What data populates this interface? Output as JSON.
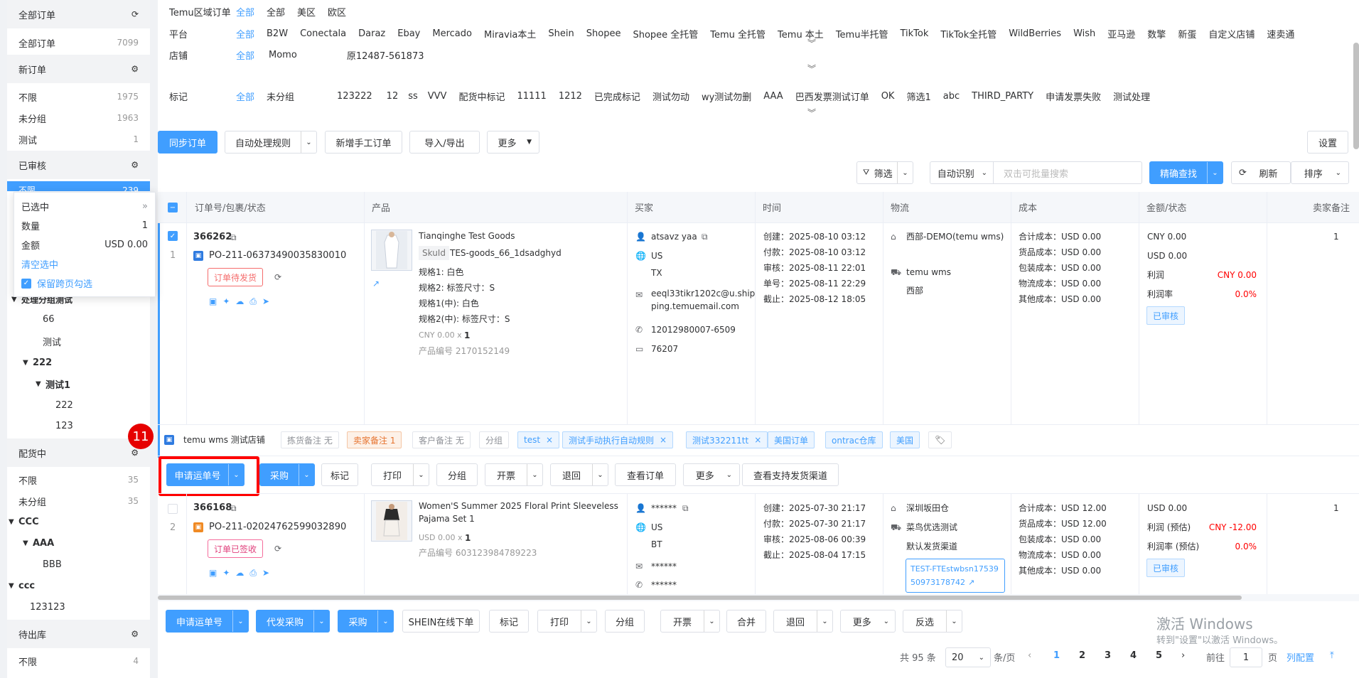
{
  "sidebar": {
    "all_orders": {
      "title": "全部订单",
      "item": {
        "label": "全部订单",
        "count": "7099"
      }
    },
    "new_orders": {
      "title": "新订单",
      "items": [
        {
          "label": "不限",
          "count": "1975"
        },
        {
          "label": "未分组",
          "count": "1963"
        },
        {
          "label": "测试",
          "count": "1"
        }
      ]
    },
    "approved": {
      "title": "已审核",
      "active_label": "不限",
      "active_count": "239"
    },
    "tree_a": {
      "group": "处理分组测试",
      "items": [
        "66",
        "测试"
      ],
      "sub": "222",
      "sub2": "测试1",
      "leaves": [
        "222",
        "123"
      ]
    },
    "picking": {
      "title": "配货中",
      "items": [
        {
          "label": "不限",
          "count": "35"
        },
        {
          "label": "未分组",
          "count": "35"
        }
      ],
      "tree": {
        "a": "CCC",
        "b": "AAA",
        "c": "BBB",
        "d": "ccc",
        "e": "123123"
      }
    },
    "outbound": {
      "title": "待出库",
      "items": [
        {
          "label": "不限",
          "count": "4"
        }
      ]
    }
  },
  "popover": {
    "selected": "已选中",
    "qty_label": "数量",
    "qty": "1",
    "amount_label": "金额",
    "amount": "USD 0.00",
    "clear": "清空选中",
    "keep": "保留跨页勾选"
  },
  "filters": {
    "region": {
      "label": "Temu区域订单",
      "options": [
        "全部",
        "全部",
        "美区",
        "欧区"
      ]
    },
    "platform": {
      "label": "平台",
      "options": [
        "全部",
        "B2W",
        "Conectala",
        "Daraz",
        "Ebay",
        "Mercado",
        "Miravia本土",
        "Shein",
        "Shopee",
        "Shopee 全托管",
        "Temu 全托管",
        "Temu 本土",
        "Temu半托管",
        "TikTok",
        "TikTok全托管",
        "WildBerries",
        "Wish",
        "亚马逊",
        "数擎",
        "新蛋",
        "自定义店铺",
        "速卖通"
      ]
    },
    "store": {
      "label": "店铺",
      "options": [
        "全部",
        "Momo",
        "原12487-561873"
      ]
    },
    "mark": {
      "label": "标记",
      "options": [
        "全部",
        "未分组",
        "123222",
        "12",
        "ss",
        "VVV",
        "配货中标记",
        "11111",
        "1212",
        "已完成标记",
        "测试勿动",
        "wy测试勿删",
        "AAA",
        "巴西发票测试订单",
        "OK",
        "筛选1",
        "abc",
        "THIRD_PARTY",
        "申请发票失败",
        "测试处理"
      ]
    }
  },
  "toolbar": {
    "sync": "同步订单",
    "auto_rule": "自动处理规则",
    "new_manual": "新增手工订单",
    "import_export": "导入/导出",
    "more": "更多",
    "settings": "设置"
  },
  "search": {
    "filter": "筛选",
    "auto_detect": "自动识别",
    "placeholder": "双击可批量搜索",
    "precise": "精确查找",
    "refresh": "刷新",
    "sort": "排序"
  },
  "table": {
    "headers": [
      "订单号/包裹/状态",
      "产品",
      "买家",
      "时间",
      "物流",
      "成本",
      "金额/状态",
      "卖家备注"
    ]
  },
  "order1": {
    "index": "1",
    "id": "366262",
    "po": "PO-211-06373490035830010",
    "status": "订单待发货",
    "product": {
      "title": "Tianqinghe Test Goods",
      "sku_label": "SkuId",
      "sku": "TES-goods_66_1dsadghyd",
      "specs": [
        "规格1: 白色",
        "规格2: 标签尺寸：S",
        "规格1(中): 白色",
        "规格2(中): 标签尺寸：S"
      ],
      "price": "CNY 0.00 x",
      "qty": "1",
      "code": "产品编号  2170152149"
    },
    "buyer": {
      "name": "atsavz yaa",
      "country": "US",
      "state": "TX",
      "email": "eeql33tikr1202c@u.shipping.temuemail.com",
      "phone": "12012980007-6509",
      "zip": "76207"
    },
    "time": [
      "创建：2025-08-10 03:12",
      "付款：2025-08-10 03:12",
      "审核：2025-08-11 22:01",
      "单号：2025-08-11 22:29",
      "截止：2025-08-12 18:05"
    ],
    "logistics": {
      "warehouse": "西部-DEMO(temu wms)",
      "carrier": "temu wms",
      "channel": "西部"
    },
    "cost": [
      "合计成本：USD 0.00",
      "货品成本：USD 0.00",
      "包装成本：USD 0.00",
      "物流成本：USD 0.00",
      "其他成本：USD 0.00"
    ],
    "amount": {
      "cny": "CNY 0.00",
      "usd": "USD 0.00",
      "profit_label": "利润",
      "profit": "CNY 0.00",
      "rate_label": "利润率",
      "rate": "0.0%",
      "state": "已审核"
    },
    "seller_note": "1",
    "store": "temu wms 测试店铺",
    "tags": {
      "pick": "拣货备注 无",
      "seller": "卖家备注 1",
      "customer": "客户备注 无",
      "group": "分组",
      "list": [
        "test",
        "测试手动执行自动规则",
        "测试332211tt",
        "美国订单",
        "ontrac仓库",
        "美国"
      ]
    },
    "actions": [
      "申请运单号",
      "采购",
      "标记",
      "打印",
      "分组",
      "开票",
      "退回",
      "查看订单",
      "更多",
      "查看支持发货渠道"
    ]
  },
  "order2": {
    "index": "2",
    "id": "366168",
    "po": "PO-211-02024762599032890",
    "status": "订单已签收",
    "product": {
      "title": "Women'S Summer 2025 Floral Print Sleeveless Pajama Set 1",
      "price": "USD 0.00 x",
      "qty": "1",
      "code": "产品编号  603123984789223"
    },
    "buyer": {
      "name": "******",
      "country": "US",
      "state": "BT",
      "email": "******",
      "phone": "******"
    },
    "time": [
      "创建：2025-07-30 21:17",
      "付款：2025-07-30 21:17",
      "审核：2025-08-06 00:39",
      "截止：2025-08-04 17:15"
    ],
    "logistics": {
      "warehouse": "深圳坂田仓",
      "carrier": "菜鸟优选测试",
      "channel": "默认发货渠道",
      "tracking": "TEST-FTEstwbsn1753950973178742"
    },
    "cost": [
      "合计成本：USD 12.00",
      "货品成本：USD 12.00",
      "包装成本：USD 0.00",
      "物流成本：USD 0.00",
      "其他成本：USD 0.00"
    ],
    "amount": {
      "usd": "USD 0.00",
      "profit_label": "利润 (预估)",
      "profit": "CNY -12.00",
      "rate_label": "利润率 (预估)",
      "rate": "0.0%",
      "state": "已审核"
    },
    "seller_note": "1"
  },
  "step_badge": "11",
  "bottom": {
    "actions": [
      "申请运单号",
      "代发采购",
      "采购",
      "SHEIN在线下单",
      "标记",
      "打印",
      "分组",
      "开票",
      "合并",
      "退回",
      "更多",
      "反选"
    ]
  },
  "pager": {
    "total": "共 95 条",
    "size": "20",
    "per": "条/页",
    "pages": [
      "1",
      "2",
      "3",
      "4",
      "5"
    ],
    "goto": "前往",
    "page": "1",
    "page_unit": "页",
    "config": "列配置"
  },
  "watermark": {
    "line1": "激活 Windows",
    "line2": "转到\"设置\"以激活 Windows。"
  },
  "colors": {
    "primary": "#409eff",
    "red": "#ff0000",
    "highlight": "#ff0000"
  }
}
